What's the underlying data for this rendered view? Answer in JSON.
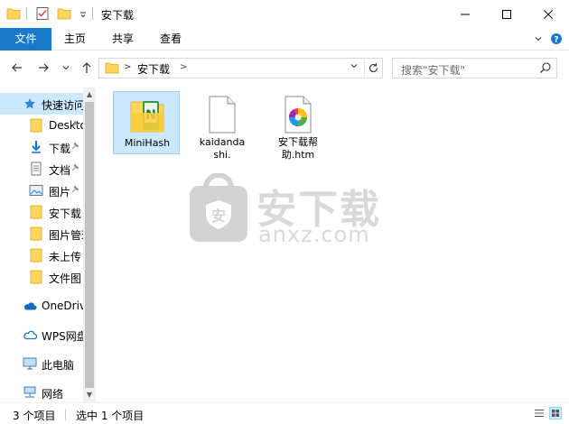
{
  "window": {
    "title": "安下载",
    "minimize_glyph": "—",
    "maximize_glyph": "☐",
    "close_glyph": "✕"
  },
  "ribbon": {
    "tabs": [
      {
        "label": "文件"
      },
      {
        "label": "主页"
      },
      {
        "label": "共享"
      },
      {
        "label": "查看"
      }
    ]
  },
  "address": {
    "path": "安下载",
    "chevron": ">"
  },
  "search": {
    "placeholder": "搜索\"安下载\""
  },
  "navpane": {
    "items": [
      {
        "label": "快速访问",
        "icon": "star-icon"
      },
      {
        "label": "Desktop",
        "icon": "folder-icon",
        "pinned": true
      },
      {
        "label": "下载",
        "icon": "download-arrow-icon",
        "pinned": true
      },
      {
        "label": "文档",
        "icon": "document-icon",
        "pinned": true
      },
      {
        "label": "图片",
        "icon": "picture-icon",
        "pinned": true
      },
      {
        "label": "安下载",
        "icon": "folder-icon"
      },
      {
        "label": "图片管理",
        "icon": "folder-icon"
      },
      {
        "label": "未上传",
        "icon": "folder-icon"
      },
      {
        "label": "文件图",
        "icon": "folder-icon"
      },
      {
        "label": "OneDrive",
        "icon": "cloud-icon"
      },
      {
        "label": "WPS网盘",
        "icon": "wps-cloud-icon"
      },
      {
        "label": "此电脑",
        "icon": "computer-icon"
      },
      {
        "label": "网络",
        "icon": "network-icon"
      }
    ],
    "pin_glyph": "📌"
  },
  "files": [
    {
      "name": "MiniHash",
      "icon": "minihash-folder-icon",
      "selected": true
    },
    {
      "name": "kaidandashi.",
      "icon": "blank-file-icon",
      "selected": false
    },
    {
      "name": "安下载帮助.htm",
      "icon": "htm-file-icon",
      "selected": false
    }
  ],
  "watermark": {
    "text": "安下载",
    "sub": "anxz.com",
    "logo_char": "安"
  },
  "status": {
    "count": "3 个项目",
    "selection": "选中 1 个项目"
  },
  "colors": {
    "accent": "#1979ca",
    "selection_bg": "#cce8ff",
    "selection_border": "#99d1ff",
    "folder_yellow": "#ffd55c"
  }
}
